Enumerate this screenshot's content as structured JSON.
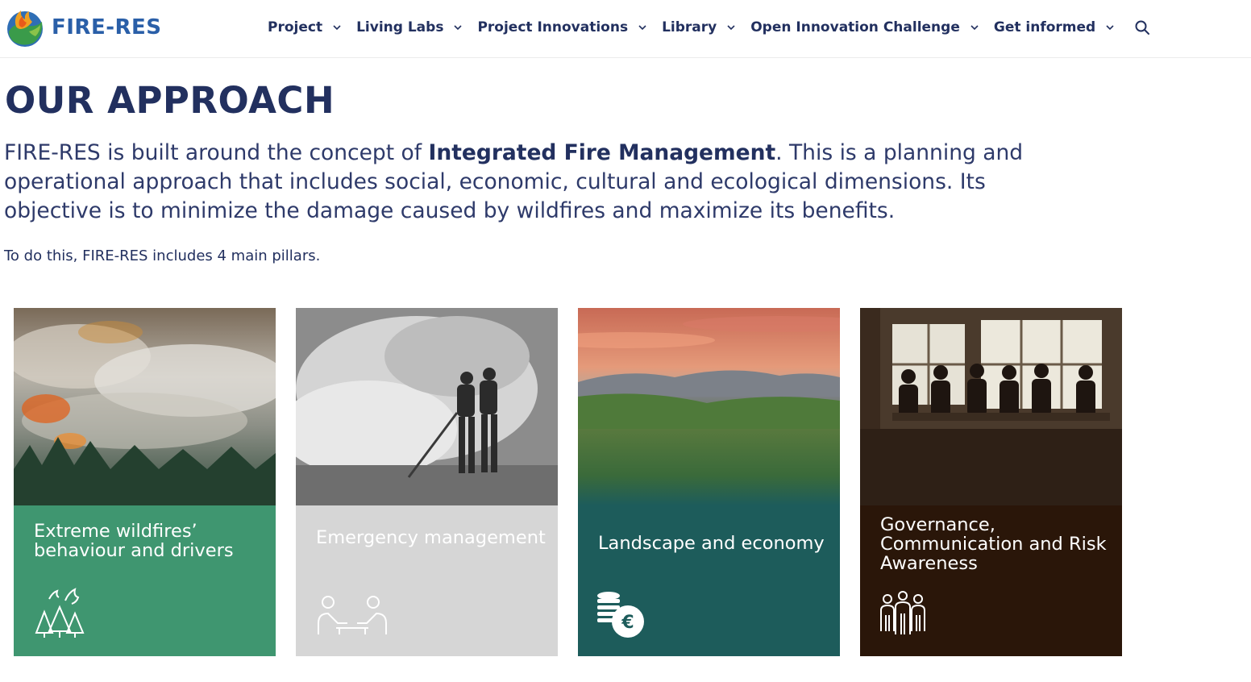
{
  "brand": {
    "name": "FIRE-RES"
  },
  "nav": {
    "items": [
      {
        "label": "Project"
      },
      {
        "label": "Living Labs"
      },
      {
        "label": "Project Innovations"
      },
      {
        "label": "Library"
      },
      {
        "label": "Open Innovation Challenge"
      },
      {
        "label": "Get informed"
      }
    ],
    "search_icon": "search-icon"
  },
  "page": {
    "title": "OUR APPROACH",
    "lead_before": "FIRE-RES is built around the concept of ",
    "lead_bold": "Integrated Fire Management",
    "lead_after": ". This is a planning and operational approach that includes social, economic, cultural and ecological dimensions. Its objective is to minimize the damage caused by wildfires and maximize its benefits.",
    "sub": "To do this, FIRE-RES includes 4 main pillars."
  },
  "pillars": [
    {
      "title": "Extreme wildfires’ behaviour and drivers",
      "color": "#3f9670",
      "icon": "burning-trees-icon"
    },
    {
      "title": "Emergency management",
      "color": "#d6d6d6",
      "icon": "people-at-table-icon"
    },
    {
      "title": "Landscape and economy",
      "color": "#1d5c5b",
      "icon": "coins-euro-icon"
    },
    {
      "title": "Governance, Communication and Risk Awareness",
      "color": "#2a1609",
      "icon": "group-of-people-icon"
    }
  ]
}
